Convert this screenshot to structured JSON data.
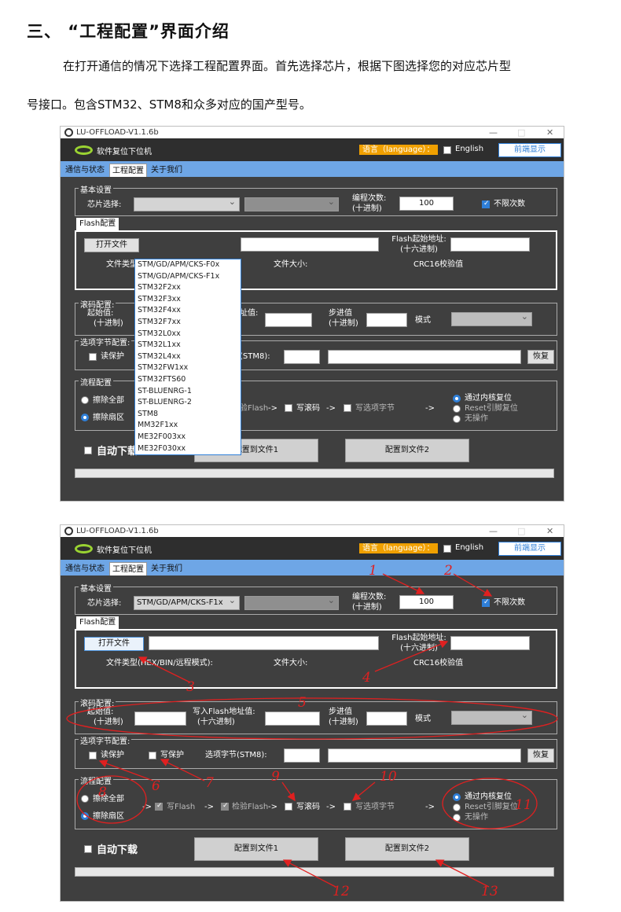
{
  "doc": {
    "heading": "三、 “工程配置”界面介绍",
    "para1": "在打开通信的情况下选择工程配置界面。首先选择芯片，根据下图选择您的对应芯片型",
    "para2": "号接口。包含STM32、STM8和众多对应的国产型号。"
  },
  "app": {
    "window_title": "LU-OFFLOAD-V1.1.6b",
    "min_icon": "—",
    "max_icon": "□",
    "close_icon": "✕",
    "app_name": "软件复位下位机",
    "language_label": "语言（language）：",
    "english_label": "English",
    "topmost_button": "前端显示",
    "tabs": [
      "通信与状态",
      "工程配置",
      "关于我们"
    ],
    "basic_group": "基本设置",
    "chip_label": "芯片选择:",
    "chip_value_shot2": "STM/GD/APM/CKS-F1x",
    "prog_count_label": "编程次数:",
    "prog_count_sub": "(十进制)",
    "prog_count_value": "100",
    "unlimited_label": "不限次数",
    "flash_tab": "Flash配置",
    "open_file_button": "打开文件",
    "flash_addr_label": "Flash起始地址:",
    "flash_addr_sub": "(十六进制)",
    "file_type_label": "文件类型(HEX/BIN/远程模式):",
    "file_type_label_short": "文件类型",
    "file_size_label": "文件大小:",
    "crc_label": "CRC16校验值",
    "roll_group": "滚码配置:",
    "start_label": "起始值:",
    "start_sub": "(十进制)",
    "write_addr_label": "写入Flash地址值:",
    "write_addr_sub": "(十六进制)",
    "write_addr_partial": "址值:",
    "step_label": "步进值",
    "step_sub": "(十进制)",
    "mode_label": "模式",
    "option_group": "选项字节配置:",
    "read_protect": "读保护",
    "write_protect": "写保护",
    "option_byte_label": "选项字节(STM8):",
    "option_byte_partial": "(STM8):",
    "restore_button": "恢复",
    "flow_group": "流程配置",
    "erase_all": "擦除全部",
    "erase_sector": "擦除扇区",
    "arrow": "->",
    "write_flash": "写Flash",
    "verify_flash": "检验Flash",
    "write_roll": "写滚码",
    "write_option": "写选项字节",
    "reset_core": "通过内核复位",
    "reset_pin": "Reset引脚复位",
    "no_action": "无操作",
    "auto_download": "自动下载",
    "config_file1": "配置到文件1",
    "config_file2": "配置到文件2"
  },
  "chip_options": [
    "STM/GD/APM/CKS-F0x",
    "STM/GD/APM/CKS-F1x",
    "STM32F2xx",
    "STM32F3xx",
    "STM32F4xx",
    "STM32F7xx",
    "STM32L0xx",
    "STM32L1xx",
    "STM32L4xx",
    "STM32FW1xx",
    "STM32FTS60",
    "ST-BLUENRG-1",
    "ST-BLUENRG-2",
    "STM8",
    "MM32F1xx",
    "ME32F003xx",
    "ME32F030xx"
  ],
  "annotations": [
    "1",
    "2",
    "3",
    "4",
    "5",
    "6",
    "7",
    "8",
    "9",
    "10",
    "11",
    "12",
    "13"
  ],
  "colors": {
    "app_bg": "#3f3f3f",
    "tab_bar": "#6ea6e6",
    "accent_blue": "#2f7fd8",
    "language_badge": "#f0a000",
    "annotation_red": "#e02020",
    "logo_green": "#9ad332"
  }
}
